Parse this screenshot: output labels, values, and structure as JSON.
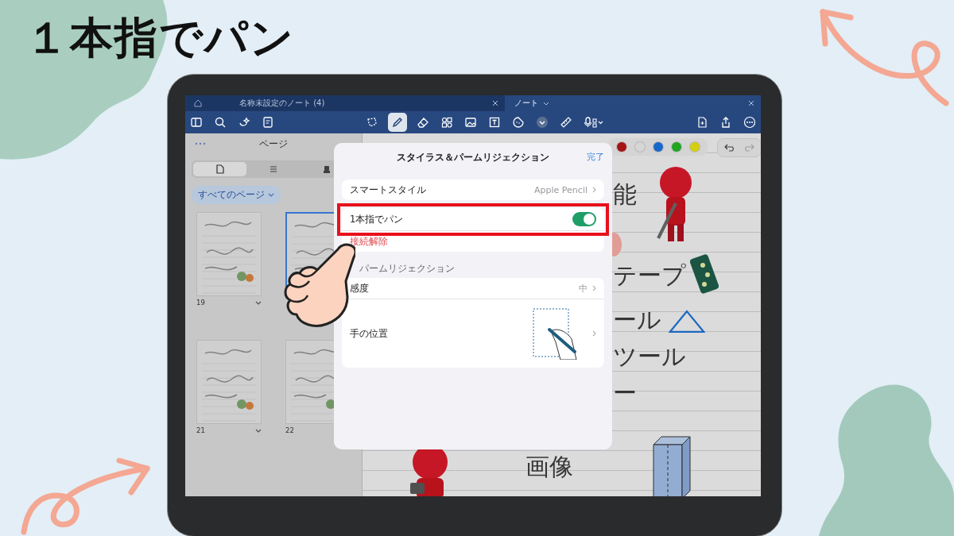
{
  "headline": "１本指でパン",
  "tabs": [
    {
      "label": "名称未設定のノート (4)",
      "selected": false
    },
    {
      "label": "ノート",
      "selected": true
    }
  ],
  "toolbar": {
    "pen_selected": true
  },
  "sidebar": {
    "title": "ページ",
    "views": [
      {
        "kind": "page",
        "selected": true
      },
      {
        "kind": "list",
        "selected": false
      },
      {
        "kind": "stamp",
        "selected": false
      }
    ],
    "filter": "すべてのページ",
    "pages": [
      {
        "number": "19",
        "selected": false
      },
      {
        "selected": true
      },
      {
        "number": "21",
        "selected": false
      },
      {
        "number": "22",
        "selected": false
      }
    ]
  },
  "palette": [
    {
      "color": "#b01515"
    },
    {
      "color": "#e4e4e4"
    },
    {
      "color": "#1a6fd8"
    },
    {
      "color": "#22b022"
    },
    {
      "color": "#e2dc10"
    }
  ],
  "note_words": [
    "能",
    "テープ",
    "ール",
    "ツール",
    "ー",
    "画像"
  ],
  "dialog": {
    "title": "スタイラス＆パームリジェクション",
    "done": "完了",
    "groups": [
      {
        "rows": [
          {
            "kind": "value",
            "label": "スマートスタイル",
            "value": "Apple Pencil"
          }
        ]
      },
      {
        "rows": [
          {
            "kind": "toggle",
            "label": "1本指でパン",
            "on": true,
            "highlighted": true
          },
          {
            "kind": "action",
            "label": "接続解除"
          }
        ]
      },
      {
        "header": "パームリジェクション",
        "rows": [
          {
            "kind": "value",
            "label": "感度",
            "value": "中"
          },
          {
            "kind": "hand",
            "label": "手の位置"
          }
        ]
      }
    ]
  }
}
